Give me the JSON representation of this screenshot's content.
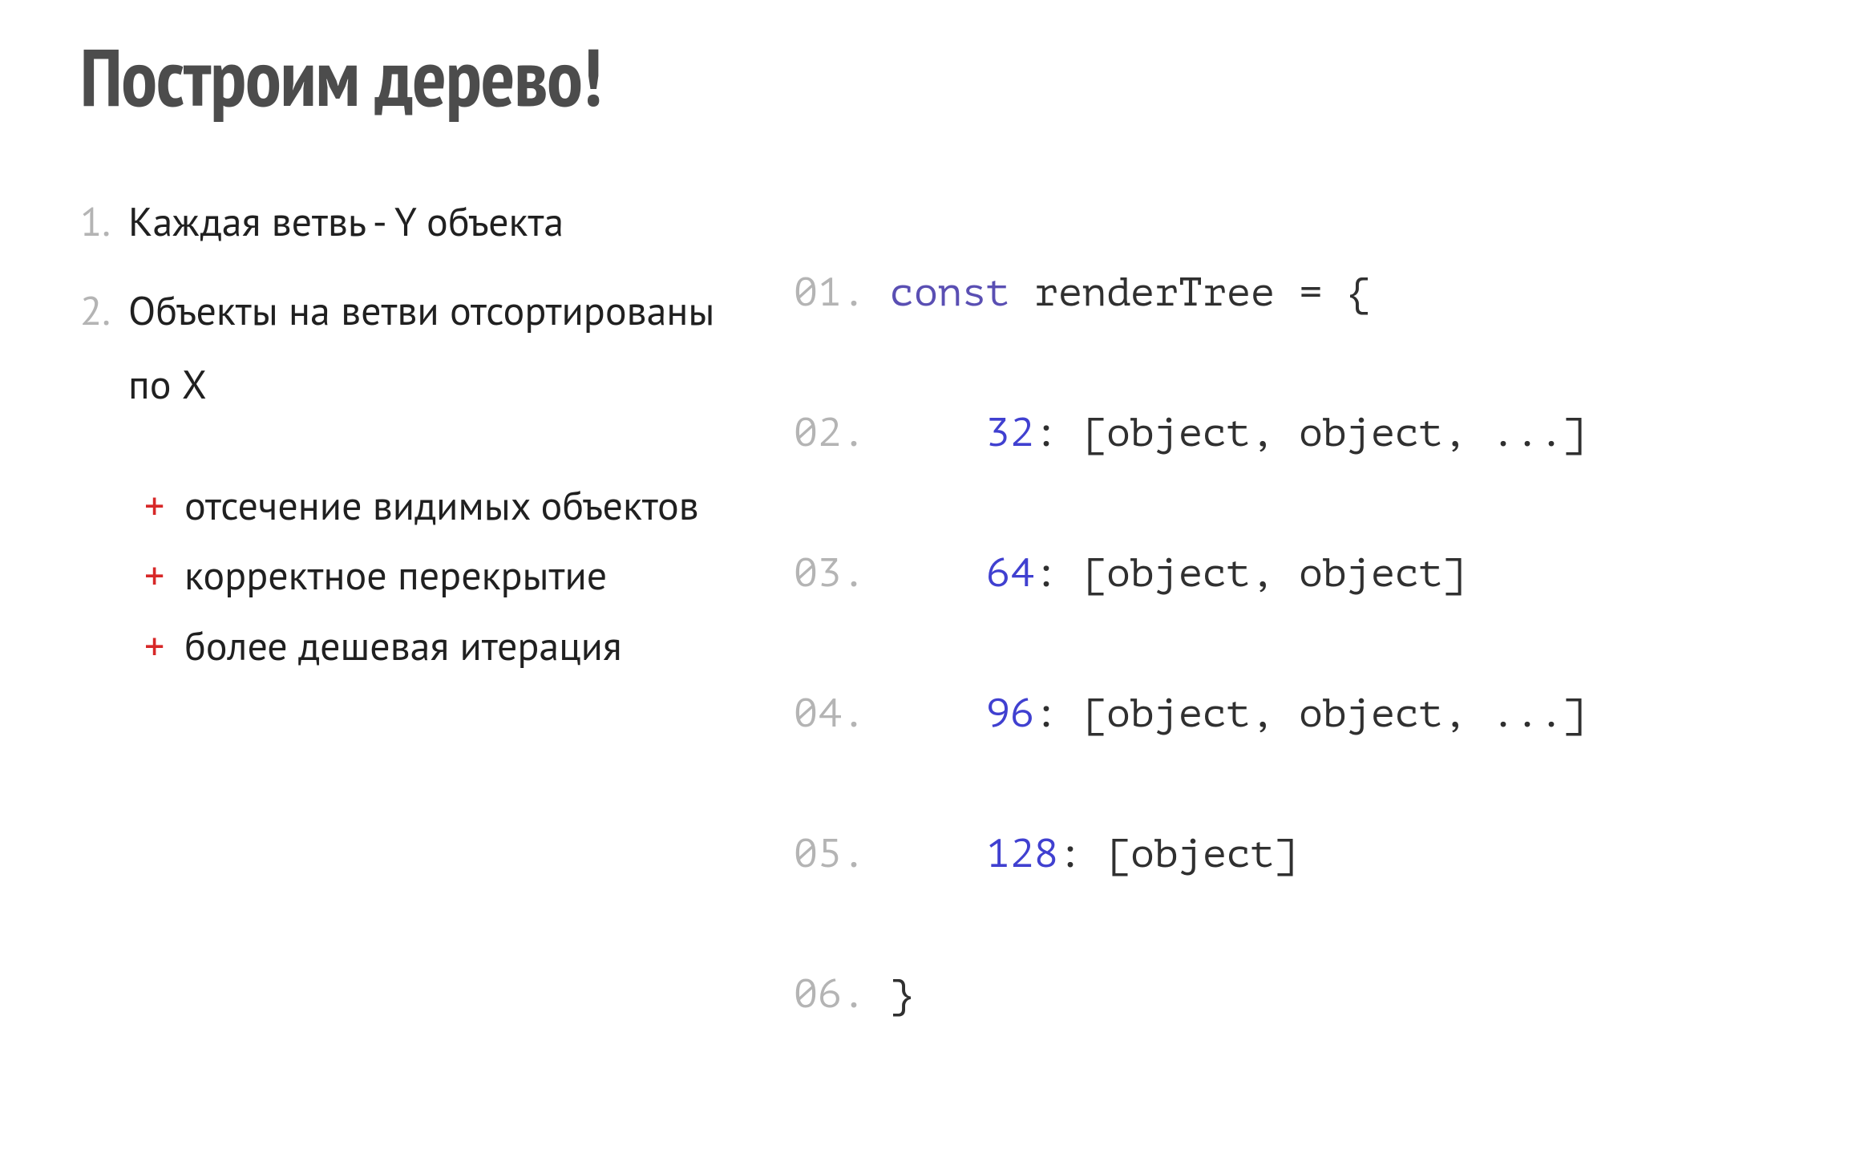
{
  "title": "Построим дерево!",
  "points": [
    "Каждая ветвь - Y объекта",
    "Объекты на ветви отсортированы по X"
  ],
  "pluses": [
    "отсечение видимых объектов",
    "корректное перекрытие",
    "более дешевая итерация"
  ],
  "code": {
    "lines": [
      {
        "no": "01.",
        "kw": "const",
        "after_kw": " renderTree = {"
      },
      {
        "no": "02.",
        "indent": "    ",
        "num": "32",
        "rest": ": [object, object, ...]"
      },
      {
        "no": "03.",
        "indent": "    ",
        "num": "64",
        "rest": ": [object, object]"
      },
      {
        "no": "04.",
        "indent": "    ",
        "num": "96",
        "rest": ": [object, object, ...]"
      },
      {
        "no": "05.",
        "indent": "    ",
        "num": "128",
        "rest": ": [object]"
      },
      {
        "no": "06.",
        "plain": "}"
      }
    ]
  }
}
